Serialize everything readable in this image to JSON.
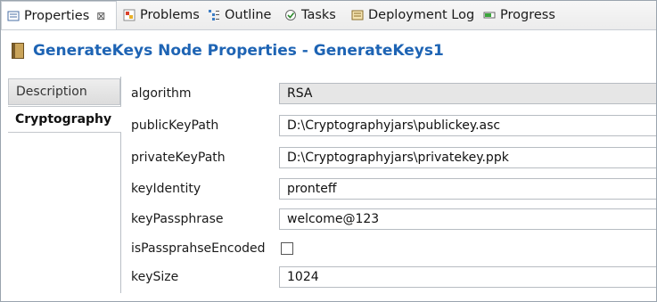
{
  "tabs": [
    {
      "label": "Properties",
      "icon": "properties-icon",
      "active": true
    },
    {
      "label": "Problems",
      "icon": "problems-icon"
    },
    {
      "label": "Outline",
      "icon": "outline-icon"
    },
    {
      "label": "Tasks",
      "icon": "tasks-icon"
    },
    {
      "label": "Deployment Log",
      "icon": "deployment-log-icon"
    },
    {
      "label": "Progress",
      "icon": "progress-icon"
    }
  ],
  "header": {
    "title": "GenerateKeys Node Properties - GenerateKeys1"
  },
  "side_tabs": [
    {
      "label": "Description",
      "active": false
    },
    {
      "label": "Cryptography",
      "active": true
    }
  ],
  "properties": {
    "algorithm": {
      "label": "algorithm",
      "value": "RSA"
    },
    "publicKeyPath": {
      "label": "publicKeyPath",
      "value": "D:\\Cryptographyjars\\publickey.asc"
    },
    "privateKeyPath": {
      "label": "privateKeyPath",
      "value": "D:\\Cryptographyjars\\privatekey.ppk"
    },
    "keyIdentity": {
      "label": "keyIdentity",
      "value": "pronteff"
    },
    "keyPassphrase": {
      "label": "keyPassphrase",
      "value": "welcome@123"
    },
    "isPassprahseEncoded": {
      "label": "isPassprahseEncoded",
      "checked": false
    },
    "keySize": {
      "label": "keySize",
      "value": "1024"
    }
  },
  "colors": {
    "title": "#1e64b4",
    "readonly_bg": "#e6e6e6"
  }
}
